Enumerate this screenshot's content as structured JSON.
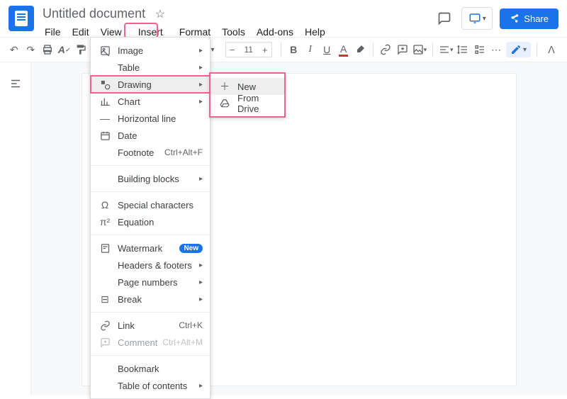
{
  "header": {
    "doc_title": "Untitled document",
    "share_label": "Share"
  },
  "menubar": {
    "file": "File",
    "edit": "Edit",
    "view": "View",
    "insert": "Insert",
    "format": "Format",
    "tools": "Tools",
    "addons": "Add-ons",
    "help": "Help"
  },
  "toolbar": {
    "font_size": "11"
  },
  "insert_menu": {
    "image": "Image",
    "table": "Table",
    "drawing": "Drawing",
    "chart": "Chart",
    "horizontal_line": "Horizontal line",
    "date": "Date",
    "footnote": "Footnote",
    "footnote_shortcut": "Ctrl+Alt+F",
    "building_blocks": "Building blocks",
    "special_characters": "Special characters",
    "equation": "Equation",
    "watermark": "Watermark",
    "watermark_badge": "New",
    "headers_footers": "Headers & footers",
    "page_numbers": "Page numbers",
    "break": "Break",
    "link": "Link",
    "link_shortcut": "Ctrl+K",
    "comment": "Comment",
    "comment_shortcut": "Ctrl+Alt+M",
    "bookmark": "Bookmark",
    "toc": "Table of contents"
  },
  "drawing_submenu": {
    "new": "New",
    "from_drive": "From Drive"
  }
}
